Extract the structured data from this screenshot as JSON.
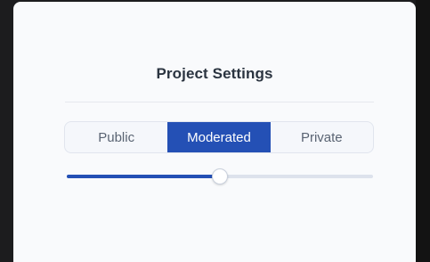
{
  "panel": {
    "title": "Project Settings"
  },
  "visibility": {
    "options": [
      "Public",
      "Moderated",
      "Private"
    ],
    "selected": "Moderated"
  },
  "slider": {
    "value_fraction": 0.5
  },
  "colors": {
    "accent": "#2450b5",
    "track": "#dde2ec",
    "title": "#2b3440",
    "background": "#f9fafc"
  }
}
